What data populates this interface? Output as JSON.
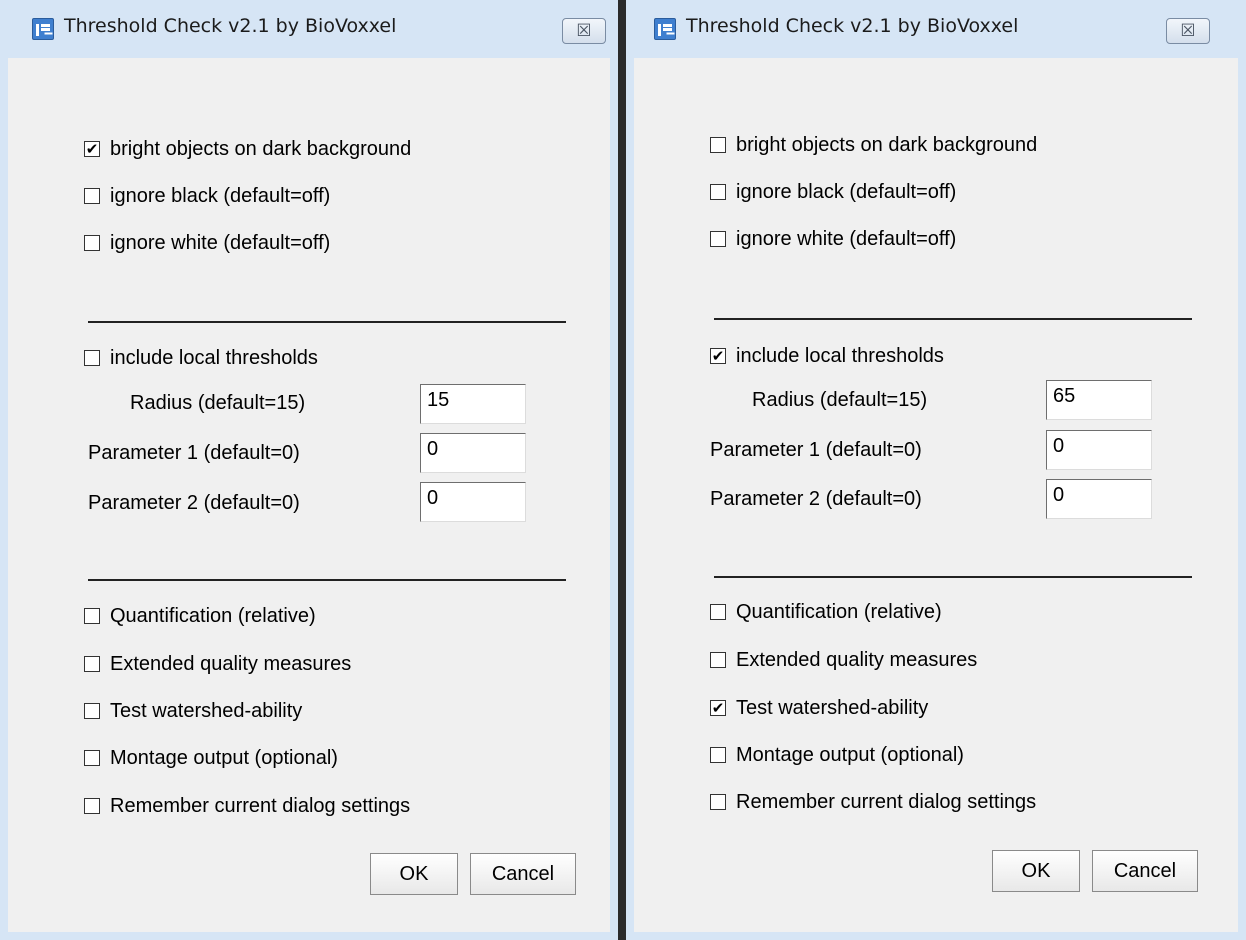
{
  "dialogs": [
    {
      "title": "Threshold Check v2.1 by BioVoxxel",
      "close_symbol": "☒",
      "checkboxes_top": [
        {
          "label": "bright objects on dark background",
          "checked": true
        },
        {
          "label": "ignore black (default=off)",
          "checked": false
        },
        {
          "label": "ignore white (default=off)",
          "checked": false
        }
      ],
      "local_thresholds": {
        "label": "include local thresholds",
        "checked": false
      },
      "fields": [
        {
          "label": "Radius (default=15)",
          "value": "15"
        },
        {
          "label": "Parameter 1 (default=0)",
          "value": "0"
        },
        {
          "label": "Parameter 2 (default=0)",
          "value": "0"
        }
      ],
      "checkboxes_bottom": [
        {
          "label": "Quantification (relative)",
          "checked": false
        },
        {
          "label": "Extended quality measures",
          "checked": false
        },
        {
          "label": "Test watershed-ability",
          "checked": false
        },
        {
          "label": "Montage output (optional)",
          "checked": false
        },
        {
          "label": "Remember current dialog settings",
          "checked": false
        }
      ],
      "ok_label": "OK",
      "cancel_label": "Cancel"
    },
    {
      "title": "Threshold Check v2.1 by BioVoxxel",
      "close_symbol": "☒",
      "checkboxes_top": [
        {
          "label": "bright objects on dark background",
          "checked": false
        },
        {
          "label": "ignore black (default=off)",
          "checked": false
        },
        {
          "label": "ignore white (default=off)",
          "checked": false
        }
      ],
      "local_thresholds": {
        "label": "include local thresholds",
        "checked": true
      },
      "fields": [
        {
          "label": "Radius (default=15)",
          "value": "65"
        },
        {
          "label": "Parameter 1 (default=0)",
          "value": "0"
        },
        {
          "label": "Parameter 2 (default=0)",
          "value": "0"
        }
      ],
      "checkboxes_bottom": [
        {
          "label": "Quantification (relative)",
          "checked": false
        },
        {
          "label": "Extended quality measures",
          "checked": false
        },
        {
          "label": "Test watershed-ability",
          "checked": true
        },
        {
          "label": "Montage output (optional)",
          "checked": false
        },
        {
          "label": "Remember current dialog settings",
          "checked": false
        }
      ],
      "ok_label": "OK",
      "cancel_label": "Cancel"
    }
  ]
}
